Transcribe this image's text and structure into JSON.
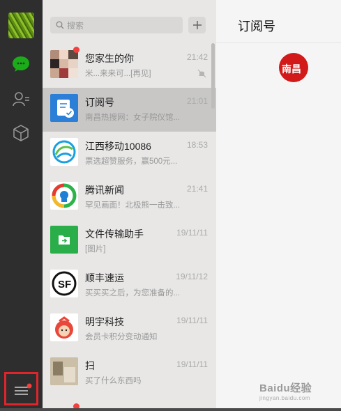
{
  "search": {
    "placeholder": "搜索"
  },
  "panel": {
    "title": "订阅号",
    "sub_badge": "南昌"
  },
  "watermark": {
    "brand": "Baidu经验",
    "url": "jingyan.baidu.com"
  },
  "chats": [
    {
      "name": "您家生的你",
      "preview": "米...来来可...[再见]",
      "time": "21:42"
    },
    {
      "name": "订阅号",
      "preview": "南昌热搜网：女子院仪馆...",
      "time": "21:01"
    },
    {
      "name": "江西移动10086",
      "preview": "票选超赞服务，赢500元...",
      "time": "18:53"
    },
    {
      "name": "腾讯新闻",
      "preview": "罕见画面！北极熊一击致...",
      "time": "21:41"
    },
    {
      "name": "文件传输助手",
      "preview": "[图片]",
      "time": "19/11/11"
    },
    {
      "name": "顺丰速运",
      "preview": "买买买之后，为您准备的...",
      "time": "19/11/12"
    },
    {
      "name": "明宇科技",
      "preview": "会员卡积分变动通知",
      "time": "19/11/11"
    },
    {
      "name": "扫",
      "preview": "买了什么东西吗",
      "time": "19/11/11"
    }
  ],
  "colors": {
    "nav_bg": "#2e2e2e",
    "list_bg": "#e8e7e6",
    "selected_bg": "#c8c7c6",
    "accent_green": "#1aad19",
    "badge_red": "#f43f3f"
  },
  "icons": [
    "chat-icon",
    "contacts-icon",
    "favorites-icon",
    "menu-icon",
    "search-icon",
    "plus-icon",
    "mute-icon"
  ]
}
